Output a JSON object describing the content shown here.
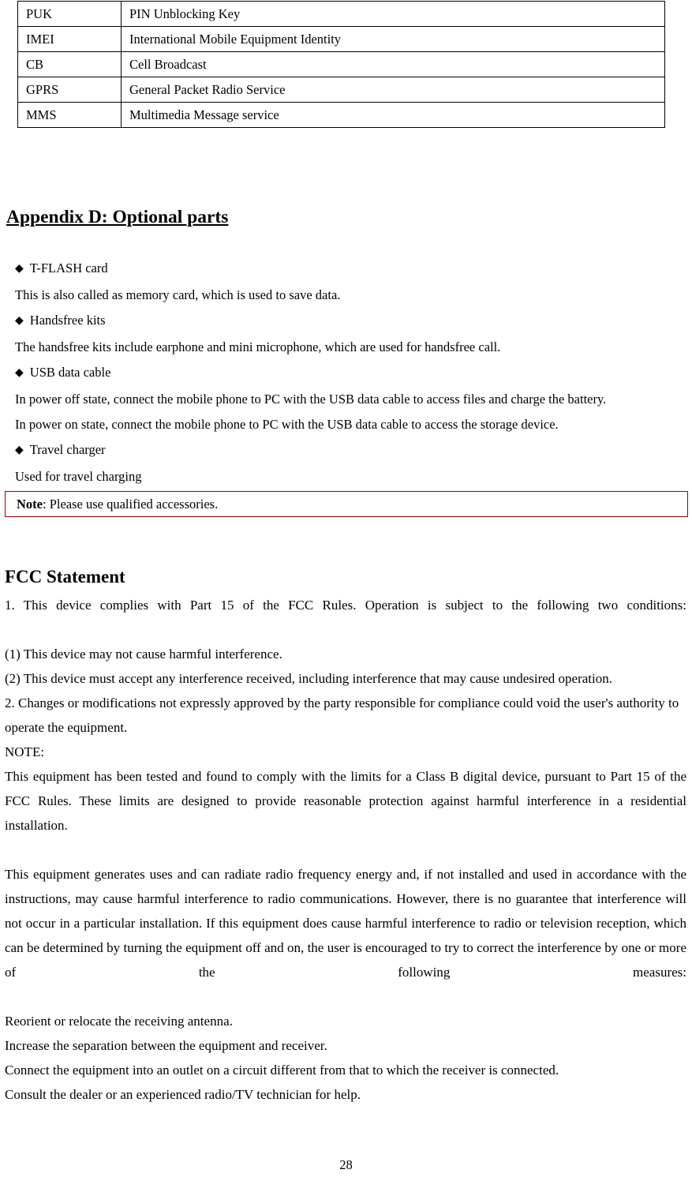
{
  "glossary_table": {
    "rows": [
      {
        "abbr": "PUK",
        "meaning": "PIN Unblocking Key"
      },
      {
        "abbr": "IMEI",
        "meaning": "International Mobile Equipment Identity"
      },
      {
        "abbr": "CB",
        "meaning": "Cell Broadcast"
      },
      {
        "abbr": "GPRS",
        "meaning": "General Packet Radio Service"
      },
      {
        "abbr": "MMS",
        "meaning": "Multimedia Message service"
      }
    ]
  },
  "appendix": {
    "heading": "Appendix D: Optional parts",
    "bullet_glyph": "◆",
    "items": [
      {
        "title": "T-FLASH card",
        "description": "This is also called as memory card, which is used to save data."
      },
      {
        "title": "Handsfree kits",
        "description": "The handsfree kits include earphone and mini microphone, which are used for handsfree call."
      },
      {
        "title": "USB data cable",
        "description": "In power off state, connect the mobile phone to PC with the USB data cable to access files and charge the battery.",
        "description_line2": "In power on state, connect the mobile phone to PC with the USB data cable to access the storage device."
      },
      {
        "title": "Travel charger",
        "description": "Used for travel charging"
      }
    ]
  },
  "note": {
    "label": "Note",
    "separator": ": ",
    "text": "Please use qualified accessories.",
    "border_color": "#9c0000"
  },
  "fcc": {
    "heading": "FCC Statement",
    "paragraphs": [
      "1. This device complies with Part 15 of the FCC Rules. Operation is subject to the following two conditions:",
      "(1) This device may not cause harmful interference.",
      "(2) This device must accept any interference received, including interference that may cause undesired operation.",
      "2. Changes or modifications not expressly approved by the party responsible for compliance could void the user's authority to operate the equipment.",
      "NOTE:",
      "This equipment has been tested and found to comply with the limits for a Class B digital device, pursuant to Part 15 of the FCC Rules. These limits are designed to provide reasonable protection against harmful interference in a residential installation.",
      "This equipment generates uses and can radiate radio frequency energy and, if not installed and used in accordance with the instructions, may cause harmful interference to radio communications. However, there is no guarantee that interference will not occur in a particular installation. If this equipment does cause harmful interference to radio or television reception, which can be determined by turning the equipment off and on, the user is encouraged to try to correct the interference by one or more of the following measures:",
      "Reorient or relocate the receiving antenna.",
      "Increase the separation between the equipment and receiver.",
      "Connect the equipment into an outlet on a circuit different from that to which the receiver is connected.",
      "Consult the dealer or an experienced radio/TV technician for help."
    ]
  },
  "footer": {
    "page_number": "28"
  }
}
